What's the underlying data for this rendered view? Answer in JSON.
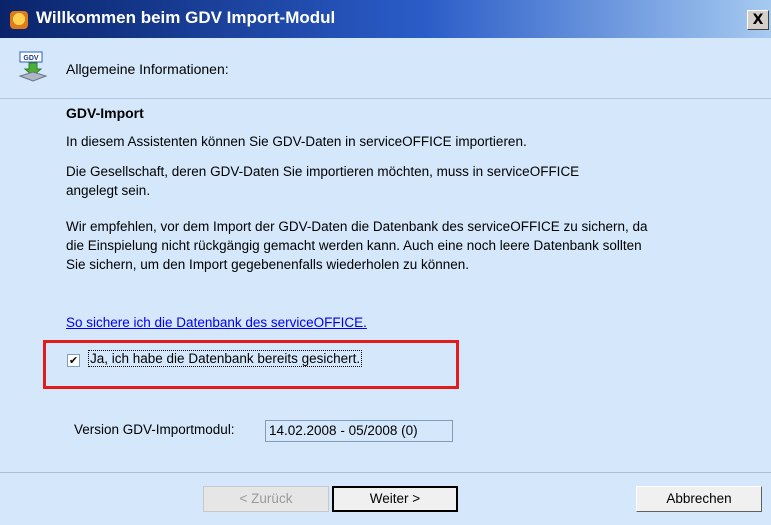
{
  "window": {
    "title": "Willkommen beim GDV Import-Modul",
    "close_label": "X"
  },
  "header": {
    "icon": "gdv-download-icon",
    "title": "Allgemeine Informationen:"
  },
  "content": {
    "heading": "GDV-Import",
    "para1": "In diesem Assistenten können Sie GDV-Daten in serviceOFFICE importieren.",
    "para2": "Die Gesellschaft, deren GDV-Daten Sie importieren möchten, muss in serviceOFFICE angelegt sein.",
    "para3": "Wir empfehlen, vor dem Import der GDV-Daten die Datenbank des serviceOFFICE zu sichern, da die Einspielung nicht rückgängig gemacht werden kann. Auch eine noch leere Datenbank sollten Sie sichern, um den Import gegebenenfalls wiederholen zu können.",
    "help_link": "So sichere ich die Datenbank des serviceOFFICE.",
    "checkbox_label": "Ja, ich habe die Datenbank bereits gesichert.",
    "checkbox_checked": true,
    "checkbox_mark": "✔",
    "version_label": "Version GDV-Importmodul:",
    "version_value": "14.02.2008 - 05/2008 (0)"
  },
  "buttons": {
    "back": "< Zurück",
    "next": "Weiter >",
    "cancel": "Abbrechen"
  },
  "colors": {
    "dialog_bg": "#d4e7fb",
    "titlebar": "#0a246a",
    "highlight": "#e21b1b",
    "link": "#0000ee"
  }
}
